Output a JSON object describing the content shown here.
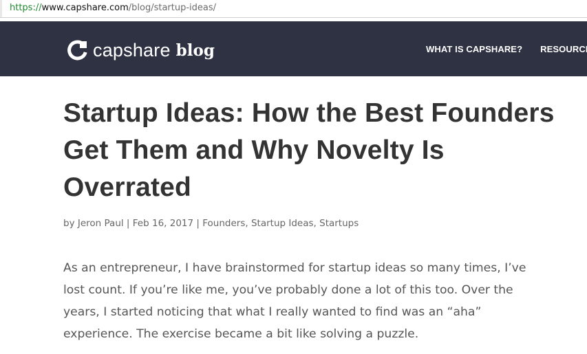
{
  "browser": {
    "url_scheme": "https://",
    "url_host": "www.capshare.com",
    "url_path": "/blog/startup-ideas/"
  },
  "header": {
    "logo_word": "capshare",
    "logo_suffix": "blog",
    "logo_icon": "capshare-logo-icon",
    "background_color": "#2e3243",
    "nav": [
      {
        "label": "WHAT IS CAPSHARE?"
      },
      {
        "label": "RESOURCE"
      }
    ]
  },
  "article": {
    "title": "Startup Ideas: How the Best Founders Get Them and Why Novelty Is Overrated",
    "meta": {
      "by": "by",
      "author": "Jeron Paul",
      "sep1": "|",
      "date": "Feb 16, 2017",
      "sep2": "|",
      "categories": [
        {
          "label": "Founders",
          "sep": ","
        },
        {
          "label": "Startup Ideas",
          "sep": ","
        },
        {
          "label": "Startups",
          "sep": ""
        }
      ]
    },
    "paragraph": "As an entrepreneur, I have brainstormed for startup ideas so many times, I’ve lost count. If you’re like me, you’ve probably done a lot of this too. Over the years, I started noticing that what I really wanted to find was an “aha” experience. The exercise became a bit like solving a puzzle."
  }
}
